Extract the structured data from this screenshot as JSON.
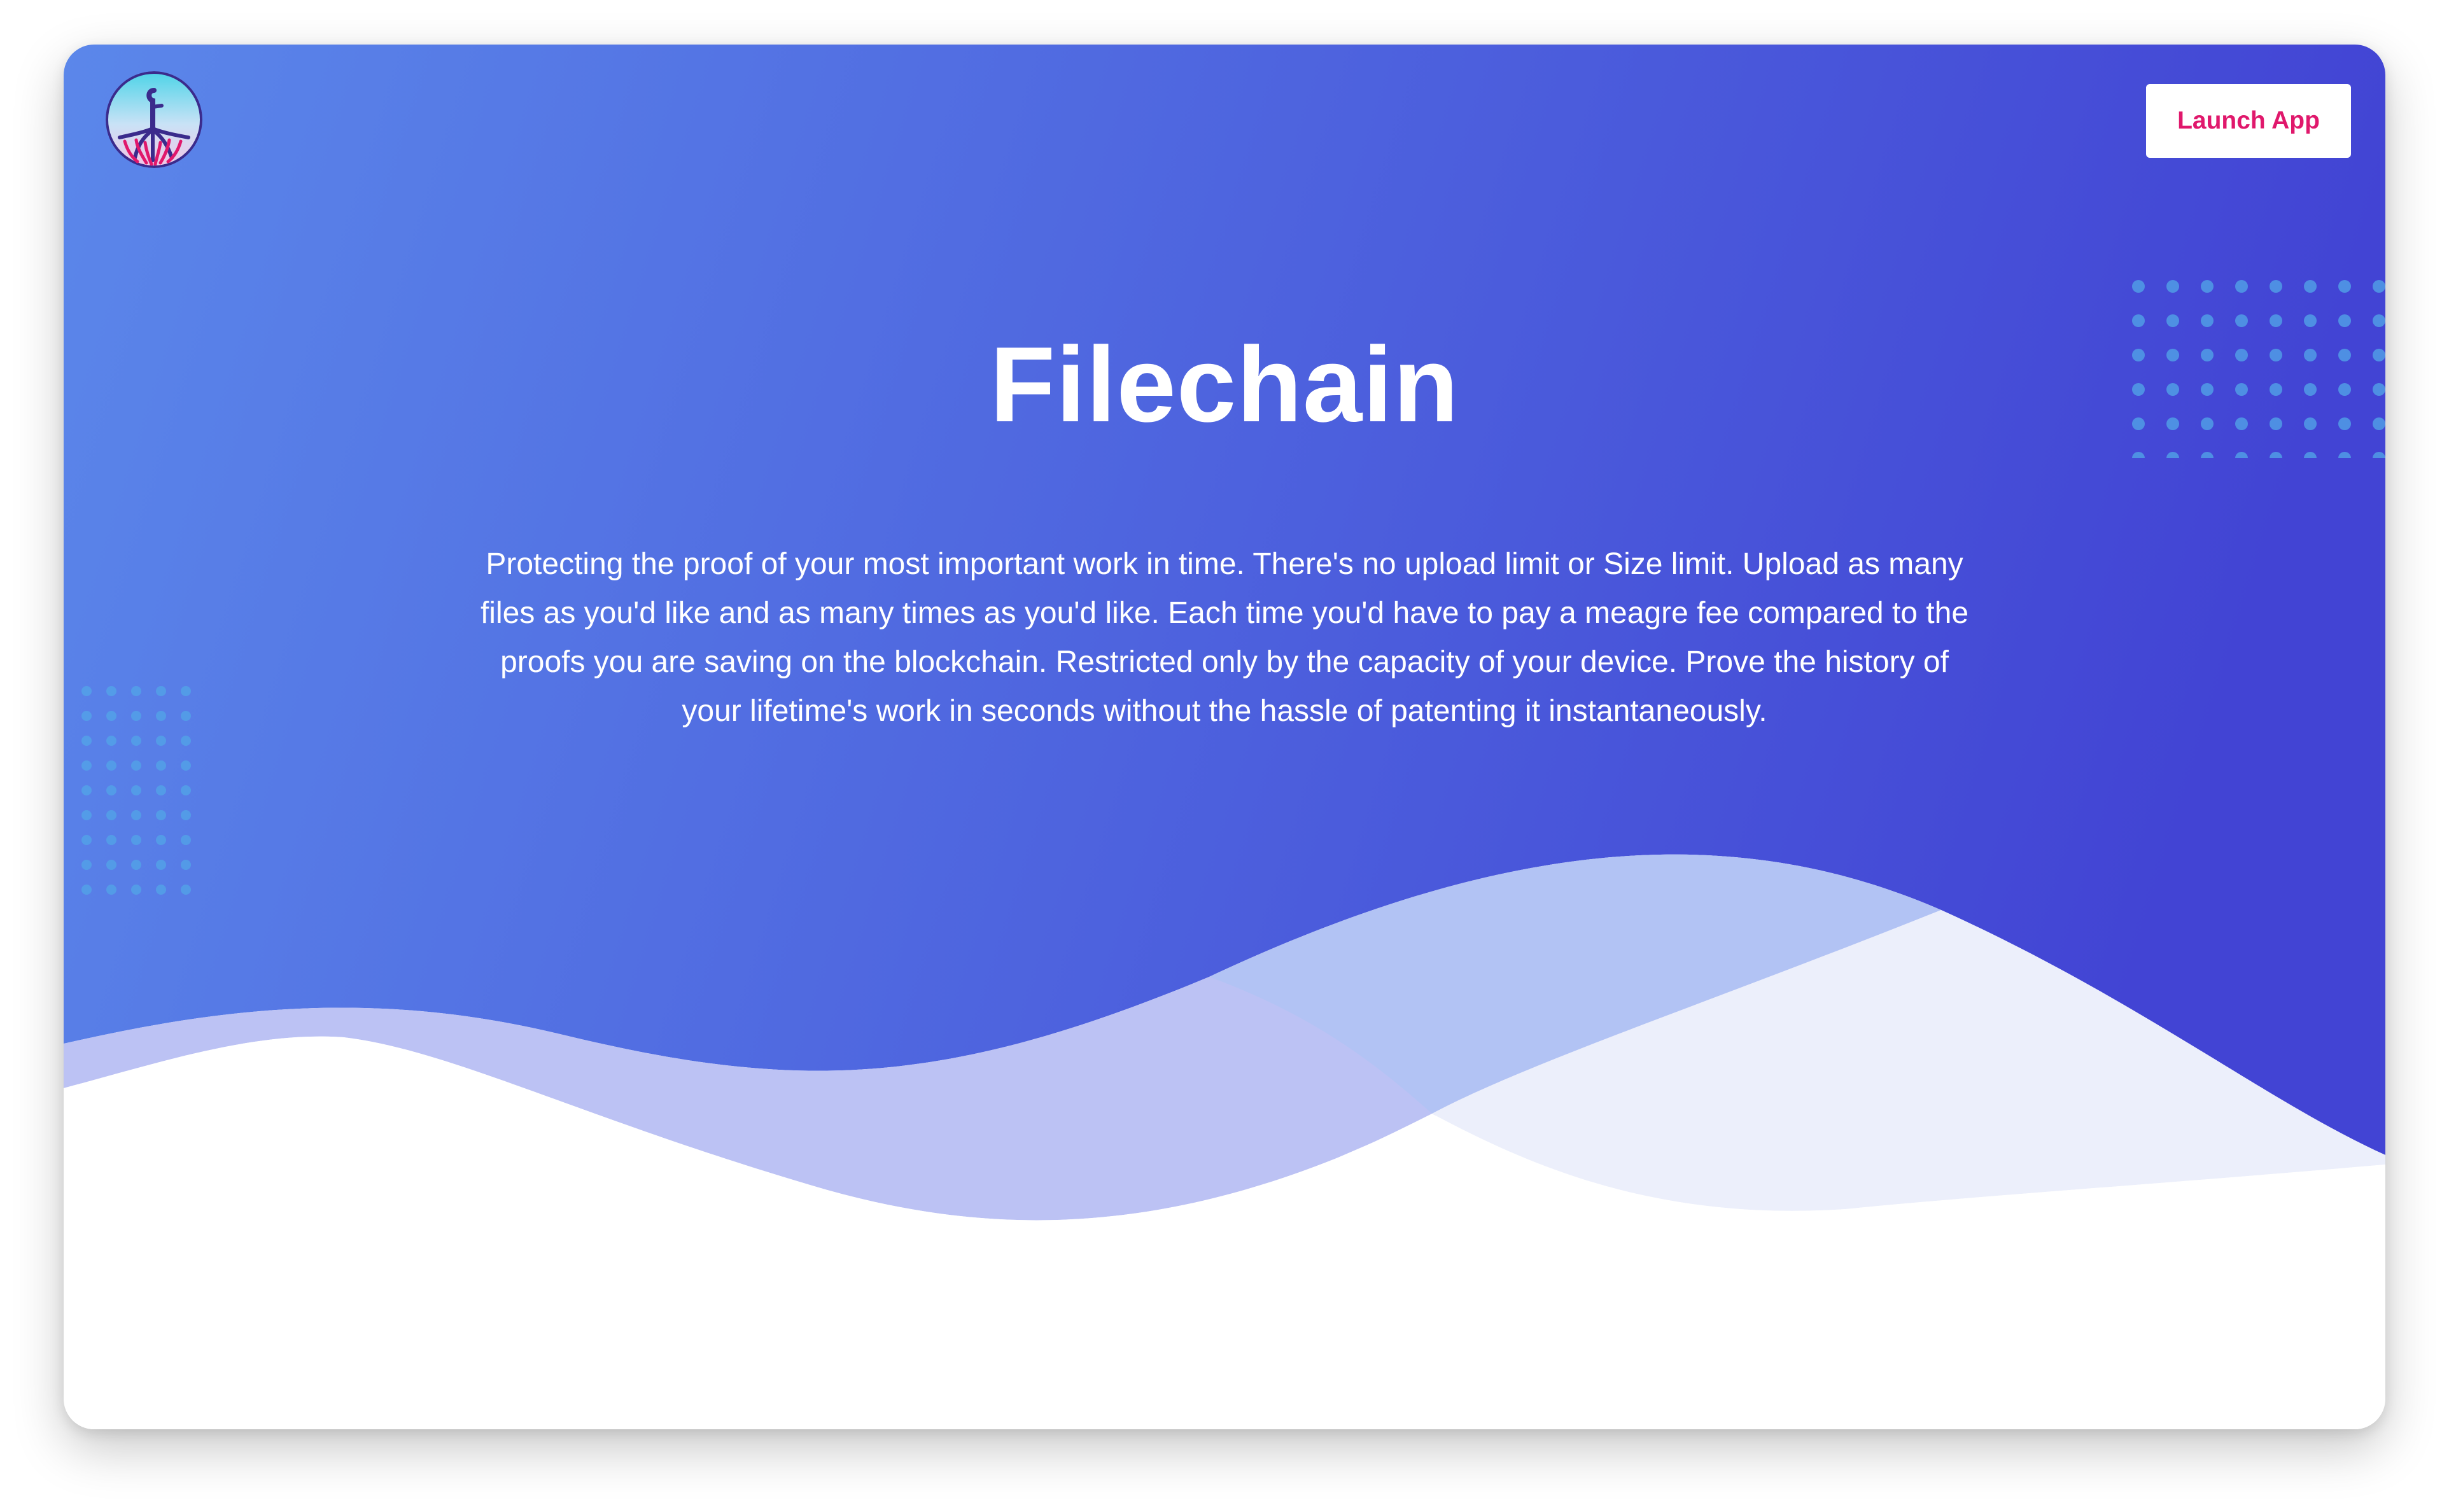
{
  "header": {
    "logo_name": "filechain-tree-logo",
    "launch_button_label": "Launch App"
  },
  "hero": {
    "title": "Filechain",
    "description": "Protecting the proof of your most important work in time. There's no upload limit or Size limit. Upload as many files as you'd like and as many times as you'd like. Each time you'd have to pay a meagre fee compared to the proofs you are saving on the blockchain. Restricted only by the capacity of your device. Prove the history of your lifetime's work in seconds without the hassle of patenting it instantaneously."
  },
  "colors": {
    "gradient_start": "#5b87ea",
    "gradient_end": "#4244d4",
    "button_text": "#e0186c",
    "dots": "#52a8e8"
  }
}
